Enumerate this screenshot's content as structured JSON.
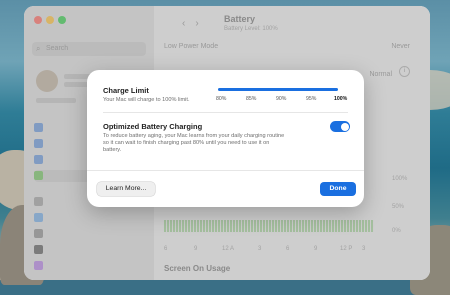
{
  "window": {
    "title": "Battery",
    "subtitle": "Battery Level: 100%",
    "search_placeholder": "Search"
  },
  "settings": {
    "low_power_label": "Low Power Mode",
    "low_power_value": "Never",
    "battery_health_value": "Normal",
    "screen_on_usage": "Screen On Usage"
  },
  "chart": {
    "xlabels": [
      "6",
      "9",
      "12 A",
      "3",
      "6",
      "9",
      "12 P",
      "3"
    ],
    "right_labels": [
      "100%",
      "50%",
      "0%"
    ]
  },
  "modal": {
    "charge_limit": {
      "title": "Charge Limit",
      "description": "Your Mac will charge to 100% limit.",
      "ticks": [
        "80%",
        "85%",
        "90%",
        "95%",
        "100%"
      ],
      "selected": "100%",
      "value_fraction": 1.0
    },
    "optimized": {
      "title": "Optimized Battery Charging",
      "description_line1": "To reduce battery aging, your Mac learns from your daily charging routine",
      "description_line2": "so it can wait to finish charging past 80% until you need to use it on",
      "description_line3": "battery.",
      "enabled": true
    },
    "learn_more_label": "Learn More...",
    "done_label": "Done"
  },
  "colors": {
    "accent": "#1a6fe0",
    "traffic_red": "#fe5f57",
    "traffic_yellow": "#febc2e",
    "traffic_green": "#28c840"
  }
}
